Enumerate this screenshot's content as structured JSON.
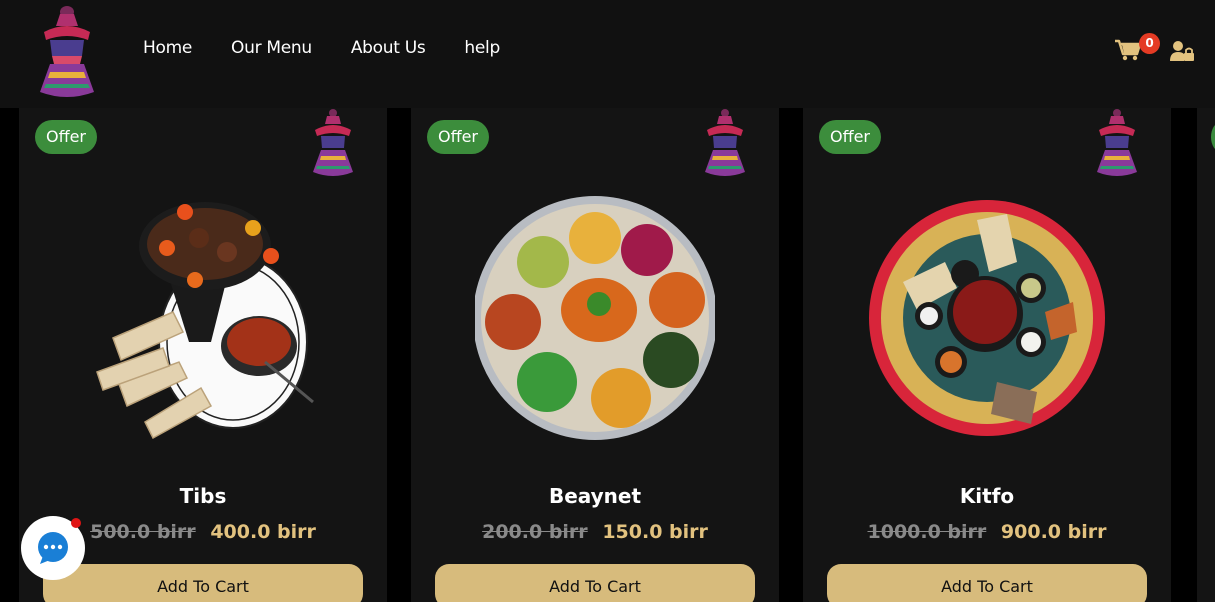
{
  "nav": {
    "items": [
      "Home",
      "Our Menu",
      "About Us",
      "help"
    ]
  },
  "cart": {
    "count": "0"
  },
  "products": [
    {
      "badge": "Offer",
      "name": "Tibs",
      "old_price": "500.0 birr",
      "new_price": "400.0 birr",
      "button": "Add To Cart"
    },
    {
      "badge": "Offer",
      "name": "Beaynet",
      "old_price": "200.0 birr",
      "new_price": "150.0 birr",
      "button": "Add To Cart"
    },
    {
      "badge": "Offer",
      "name": "Kitfo",
      "old_price": "1000.0 birr",
      "new_price": "900.0 birr",
      "button": "Add To Cart"
    }
  ],
  "colors": {
    "header_bg": "#111111",
    "card_bg": "#141414",
    "offer_green": "#3c8d3c",
    "price_gold": "#e2c27f",
    "button_gold": "#d7bb7c",
    "cart_badge": "#e43b24",
    "chat_blue": "#1a7fd6"
  },
  "icons": [
    "basket-logo-icon",
    "cart-icon",
    "user-lock-icon",
    "chat-icon"
  ]
}
